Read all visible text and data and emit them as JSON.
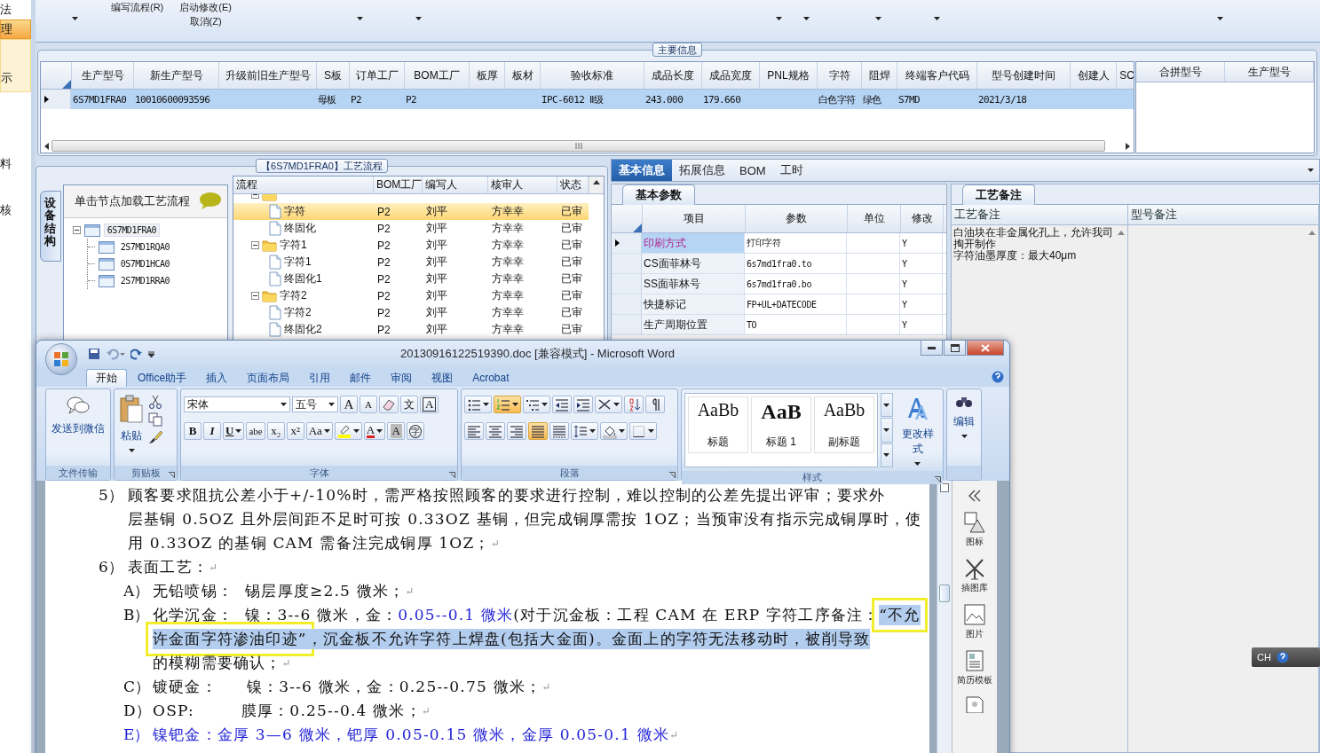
{
  "sidebar": {
    "items": [
      {
        "label": "法",
        "selected": false,
        "highlighted": false
      },
      {
        "label": "理",
        "selected": true,
        "highlighted": false
      },
      {
        "label": "示",
        "selected": false,
        "highlighted": true
      },
      {
        "label": "料",
        "selected": false,
        "highlighted": false
      },
      {
        "label": "核",
        "selected": false,
        "highlighted": false
      }
    ]
  },
  "toolbar": {
    "buttons": [
      "编写流程(R)",
      "启动修改(E)",
      "取消(Z)"
    ]
  },
  "main_info": {
    "title": "主要信息",
    "columns": [
      "生产型号",
      "新生产型号",
      "升级前旧生产型号",
      "S板",
      "订单工厂",
      "BOM工厂",
      "板厚",
      "板材",
      "验收标准",
      "成品长度",
      "成品宽度",
      "PNL规格",
      "字符",
      "阻焊",
      "终端客户代码",
      "型号创建时间",
      "创建人",
      "SC"
    ],
    "rows": [
      {
        "selected": true,
        "cells": [
          "6S7MD1FRA0",
          "10010600093596",
          null,
          "母板",
          "P2",
          "P2",
          null,
          null,
          "IPC-6012 Ⅱ级",
          "243.000",
          "179.660",
          null,
          "白色字符",
          "绿色",
          "S7MD",
          "2021/3/18",
          null,
          null
        ]
      }
    ],
    "side_columns": [
      "合拼型号",
      "生产型号"
    ]
  },
  "process_panel": {
    "title": "【6S7MD1FRA0】工艺流程",
    "side_tab": "设备结构",
    "tree_header": "单击节点加载工艺流程",
    "tree": [
      {
        "label": "6S7MD1FRA0",
        "expanded": true,
        "selected": true,
        "children": [
          {
            "label": "2S7MD1RQA0",
            "selected": false
          },
          {
            "label": "0S7MD1HCA0",
            "selected": false
          },
          {
            "label": "2S7MD1RRA0",
            "selected": false
          }
        ]
      }
    ],
    "grid": {
      "columns": [
        "流程",
        "BOM工厂",
        "编写人",
        "核审人",
        "状态"
      ],
      "rows": [
        {
          "kind": "folder",
          "expanded": true,
          "selected": false,
          "children": [
            {
              "kind": "step",
              "name": "字符",
              "selected": true,
              "cells": [
                "P2",
                "刘平",
                "方幸幸",
                "已审"
              ]
            },
            {
              "kind": "step",
              "name": "终固化",
              "selected": false,
              "cells": [
                "P2",
                "刘平",
                "方幸幸",
                "已审"
              ]
            }
          ]
        },
        {
          "kind": "folder",
          "name": "字符1",
          "expanded": true,
          "selected": false,
          "cells": [
            "P2",
            "刘平",
            "方幸幸",
            "已审"
          ],
          "children": [
            {
              "kind": "step",
              "name": "字符1",
              "selected": false,
              "cells": [
                "P2",
                "刘平",
                "方幸幸",
                "已审"
              ]
            },
            {
              "kind": "step",
              "name": "终固化1",
              "selected": false,
              "cells": [
                "P2",
                "刘平",
                "方幸幸",
                "已审"
              ]
            }
          ]
        },
        {
          "kind": "folder",
          "name": "字符2",
          "expanded": true,
          "selected": false,
          "cells": [
            "P2",
            "刘平",
            "方幸幸",
            "已审"
          ],
          "children": [
            {
              "kind": "step",
              "name": "字符2",
              "selected": false,
              "cells": [
                "P2",
                "刘平",
                "方幸幸",
                "已审"
              ]
            },
            {
              "kind": "step",
              "name": "终固化2",
              "selected": false,
              "cells": [
                "P2",
                "刘平",
                "方幸幸",
                "已审"
              ]
            }
          ]
        }
      ]
    }
  },
  "detail_panel": {
    "tabs": [
      {
        "label": "基本信息",
        "selected": true
      },
      {
        "label": "拓展信息",
        "selected": false
      },
      {
        "label": "BOM",
        "selected": false
      },
      {
        "label": "工时",
        "selected": false
      }
    ],
    "params": {
      "tab": "基本参数",
      "columns": [
        "项目",
        "参数",
        "单位",
        "修改"
      ],
      "rows": [
        {
          "selected": true,
          "cells": [
            "印刷方式",
            "打印字符",
            null,
            "Y"
          ]
        },
        {
          "selected": false,
          "cells": [
            "CS面菲林号",
            "6s7md1fra0.to",
            null,
            "Y"
          ]
        },
        {
          "selected": false,
          "cells": [
            "SS面菲林号",
            "6s7md1fra0.bo",
            null,
            "Y"
          ]
        },
        {
          "selected": false,
          "cells": [
            "快捷标记",
            "FP+UL+DATECODE",
            null,
            "Y"
          ]
        },
        {
          "selected": false,
          "cells": [
            "生产周期位置",
            "TO",
            null,
            "Y"
          ]
        }
      ]
    },
    "notes": {
      "tab": "工艺备注",
      "columns": [
        "工艺备注",
        "型号备注"
      ],
      "process_note": [
        "白油块在非金属化孔上，允许我司掏开制作",
        "字符油墨厚度：最大40μm"
      ]
    }
  },
  "word": {
    "title": "20130916122519390.doc [兼容模式] - Microsoft Word",
    "tabs": [
      {
        "label": "开始",
        "selected": true
      },
      {
        "label": "Office助手",
        "selected": false
      },
      {
        "label": "插入",
        "selected": false
      },
      {
        "label": "页面布局",
        "selected": false
      },
      {
        "label": "引用",
        "selected": false
      },
      {
        "label": "邮件",
        "selected": false
      },
      {
        "label": "审阅",
        "selected": false
      },
      {
        "label": "视图",
        "selected": false
      },
      {
        "label": "Acrobat",
        "selected": false
      }
    ],
    "ribbon": {
      "file_group": {
        "label": "文件传输",
        "button": "发送到微信"
      },
      "clipboard_group": {
        "label": "剪贴板",
        "button": "粘贴"
      },
      "font_group": {
        "label": "字体",
        "font_name": "宋体",
        "font_size": "五号",
        "row1": [
          {
            "kind": "grow",
            "glyph": "A"
          },
          {
            "kind": "shrink",
            "glyph": "A"
          },
          {
            "kind": "clear"
          },
          {
            "kind": "phonetic",
            "glyph": "文"
          },
          {
            "kind": "border",
            "glyph": "A"
          }
        ],
        "row2": [
          {
            "kind": "bold",
            "glyph": "B"
          },
          {
            "kind": "italic",
            "glyph": "I"
          },
          {
            "kind": "underline",
            "glyph": "U",
            "menu": true
          },
          {
            "kind": "strike",
            "glyph": "abe"
          },
          {
            "kind": "sub",
            "glyph": "x₂"
          },
          {
            "kind": "sup",
            "glyph": "x²"
          },
          {
            "kind": "case",
            "glyph": "Aa",
            "menu": true
          },
          {
            "kind": "highlight",
            "menu": true
          },
          {
            "kind": "color",
            "glyph": "A",
            "menu": true
          },
          {
            "kind": "shade",
            "glyph": "A"
          },
          {
            "kind": "enclose",
            "glyph": "字"
          }
        ]
      },
      "paragraph_group": {
        "label": "段落",
        "row1": [
          {
            "kind": "bullets",
            "menu": true,
            "active": false
          },
          {
            "kind": "numbering",
            "menu": true,
            "active": true
          },
          {
            "kind": "multilevel",
            "menu": true,
            "active": false
          },
          {
            "kind": "outdent",
            "menu": false,
            "active": false
          },
          {
            "kind": "indent",
            "menu": false,
            "active": false
          },
          {
            "kind": "layout",
            "menu": true,
            "active": false
          },
          {
            "kind": "sort",
            "menu": false,
            "active": false
          },
          {
            "kind": "marks",
            "menu": false,
            "active": false
          }
        ],
        "row2": [
          {
            "kind": "left",
            "menu": false,
            "active": false
          },
          {
            "kind": "center",
            "menu": false,
            "active": false
          },
          {
            "kind": "right",
            "menu": false,
            "active": false
          },
          {
            "kind": "justify",
            "menu": false,
            "active": true
          },
          {
            "kind": "distribute",
            "menu": false,
            "active": false
          },
          {
            "kind": "spacing",
            "menu": true,
            "active": false
          },
          {
            "kind": "fill",
            "menu": true,
            "active": false
          },
          {
            "kind": "borders",
            "menu": true,
            "active": false
          }
        ]
      },
      "styles_group": {
        "label": "样式",
        "styles": [
          {
            "sample": "AaBb",
            "name": "标题",
            "kind": "normal"
          },
          {
            "sample": "AaB",
            "name": "标题 1",
            "kind": "heading"
          },
          {
            "sample": "AaBb",
            "name": "副标题",
            "kind": "normal"
          }
        ],
        "change_button": "更改样式"
      },
      "editing_group": {
        "button": "编辑"
      }
    },
    "document": {
      "lines": [
        {
          "kind": "item",
          "marker": "5）",
          "segments": [
            {
              "kind": "plain",
              "text": "顾客要求阻抗公差小于+/-10%时，需严格按照顾客的要求进行控制，难以控制的公差先提出评审；要求外",
              "selected": false,
              "framed": false
            }
          ]
        },
        {
          "kind": "cont",
          "segments": [
            {
              "kind": "plain",
              "text": "层基铜 0.5OZ 且外层间距不足时可按 0.33OZ 基铜，但完成铜厚需按 1OZ；当预审没有指示完成铜厚时，使",
              "selected": false,
              "framed": false
            }
          ]
        },
        {
          "kind": "cont",
          "segments": [
            {
              "kind": "plain",
              "text": "用 0.33OZ 的基铜 CAM 需备注完成铜厚 1OZ；",
              "selected": false,
              "framed": false
            },
            {
              "kind": "mark",
              "text": "↵",
              "selected": false,
              "framed": false
            }
          ]
        },
        {
          "kind": "item",
          "marker": "6）",
          "segments": [
            {
              "kind": "plain",
              "text": "表面工艺：",
              "selected": false,
              "framed": false
            },
            {
              "kind": "mark",
              "text": "↵",
              "selected": false,
              "framed": false
            }
          ]
        },
        {
          "kind": "subitem",
          "marker": "A）",
          "segments": [
            {
              "kind": "plain",
              "text": "无铅喷锡：  锡层厚度≥2.5 微米；",
              "selected": false,
              "framed": false
            },
            {
              "kind": "mark",
              "text": "↵",
              "selected": false,
              "framed": false
            }
          ]
        },
        {
          "kind": "subitem",
          "marker": "B）",
          "segments": [
            {
              "kind": "plain",
              "text": "化学沉金：  镍：3--6 微米，金：",
              "selected": false,
              "framed": false
            },
            {
              "kind": "blue",
              "text": "0.05--0.1 微米",
              "selected": false,
              "framed": false
            },
            {
              "kind": "plain",
              "text": "(对于沉金板：工程 CAM 在 ERP 字符工序备注：",
              "selected": false,
              "framed": false
            },
            {
              "kind": "plain",
              "text": "“不允",
              "selected": true,
              "framed": true
            }
          ]
        },
        {
          "kind": "subcont",
          "segments": [
            {
              "kind": "plain",
              "text": "许金面字符渗油印迹”",
              "selected": true,
              "framed": true
            },
            {
              "kind": "plain",
              "text": "，沉金板不允许字符上焊盘(包括大金面)。金面上的字符无法移动时，被削导致",
              "selected": true,
              "framed": false
            }
          ]
        },
        {
          "kind": "subcont",
          "segments": [
            {
              "kind": "plain",
              "text": "的模糊需要确认；",
              "selected": false,
              "framed": false
            },
            {
              "kind": "mark",
              "text": "↵",
              "selected": false,
              "framed": false
            }
          ]
        },
        {
          "kind": "subitem",
          "marker": "C）",
          "segments": [
            {
              "kind": "plain",
              "text": "镀硬金：     镍：3--6 微米，金：0.25--0.75 微米；",
              "selected": false,
              "framed": false
            },
            {
              "kind": "mark",
              "text": "↵",
              "selected": false,
              "framed": false
            }
          ]
        },
        {
          "kind": "subitem",
          "marker": "D）",
          "segments": [
            {
              "kind": "plain",
              "text": "OSP:        膜厚：0.25--0.4 微米；",
              "selected": false,
              "framed": false
            },
            {
              "kind": "mark",
              "text": "↵",
              "selected": false,
              "framed": false
            }
          ]
        },
        {
          "kind": "subitem",
          "marker": "E）",
          "blue_marker": true,
          "segments": [
            {
              "kind": "blue",
              "text": "镍钯金：金厚 3—6 微米，钯厚 0.05-0.15 微米，金厚 0.05-0.1 微米",
              "selected": false,
              "framed": false
            },
            {
              "kind": "mark",
              "text": "↵",
              "selected": false,
              "framed": false
            }
          ]
        }
      ]
    },
    "task_pane": {
      "items": [
        {
          "kind": "shapes",
          "label": "图标"
        },
        {
          "kind": "clipart",
          "label": "插图库"
        },
        {
          "kind": "picture",
          "label": "图片"
        },
        {
          "kind": "resume",
          "label": "简历模板"
        },
        {
          "kind": "card"
        }
      ]
    }
  },
  "language_bar": {
    "label": "CH"
  }
}
